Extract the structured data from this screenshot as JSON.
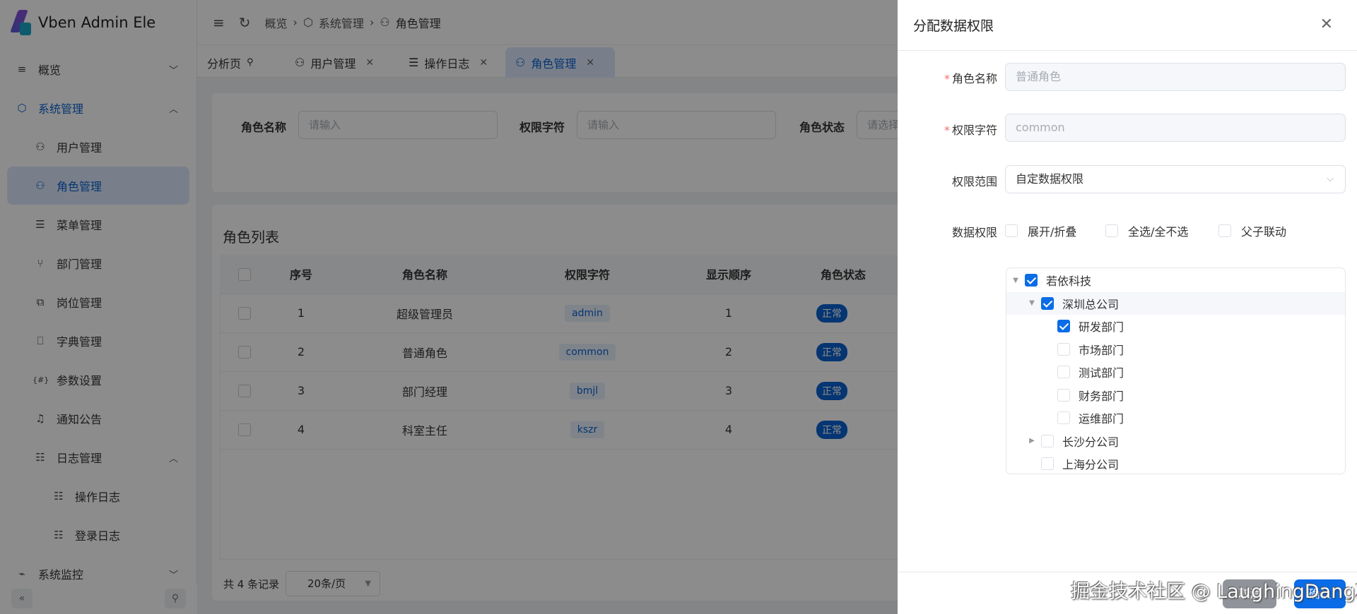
{
  "app": {
    "title": "Vben Admin Ele"
  },
  "colors": {
    "primary": "#0a6ce6",
    "required": "#f56c6c",
    "overlay": "rgba(0,0,0,0.45)"
  },
  "sidebar": {
    "items": [
      {
        "label": "概览",
        "icon": "dashboard-icon",
        "chevron": "down"
      },
      {
        "label": "系统管理",
        "icon": "system-icon",
        "chevron": "up",
        "open": true
      },
      {
        "label": "用户管理",
        "icon": "users-icon"
      },
      {
        "label": "角色管理",
        "icon": "user-role-icon",
        "active": true
      },
      {
        "label": "菜单管理",
        "icon": "menu-list-icon"
      },
      {
        "label": "部门管理",
        "icon": "org-tree-icon"
      },
      {
        "label": "岗位管理",
        "icon": "position-icon"
      },
      {
        "label": "字典管理",
        "icon": "bookmark-icon"
      },
      {
        "label": "参数设置",
        "icon": "params-icon"
      },
      {
        "label": "通知公告",
        "icon": "bell-icon"
      },
      {
        "label": "日志管理",
        "icon": "log-icon",
        "chevron": "up"
      },
      {
        "label": "操作日志",
        "icon": "oper-log-icon"
      },
      {
        "label": "登录日志",
        "icon": "login-log-icon"
      },
      {
        "label": "系统监控",
        "icon": "monitor-icon",
        "chevron": "down"
      }
    ]
  },
  "header": {
    "breadcrumb": [
      "概览",
      "系统管理",
      "角色管理"
    ]
  },
  "tabs": [
    {
      "label": "分析页",
      "closable": false
    },
    {
      "label": "用户管理",
      "closable": true
    },
    {
      "label": "操作日志",
      "closable": true
    },
    {
      "label": "角色管理",
      "closable": true,
      "active": true
    }
  ],
  "search": {
    "role_name_label": "角色名称",
    "role_name_placeholder": "请输入",
    "perm_label": "权限字符",
    "perm_placeholder": "请输入",
    "status_label": "角色状态",
    "status_placeholder": "请选择"
  },
  "table": {
    "title": "角色列表",
    "columns": [
      "序号",
      "角色名称",
      "权限字符",
      "显示顺序",
      "角色状态"
    ],
    "rows": [
      {
        "index": "1",
        "name": "超级管理员",
        "key": "admin",
        "order": "1",
        "status": "正常"
      },
      {
        "index": "2",
        "name": "普通角色",
        "key": "common",
        "order": "2",
        "status": "正常"
      },
      {
        "index": "3",
        "name": "部门经理",
        "key": "bmjl",
        "order": "3",
        "status": "正常"
      },
      {
        "index": "4",
        "name": "科室主任",
        "key": "kszr",
        "order": "4",
        "status": "正常"
      }
    ],
    "total": "共 4 条记录",
    "page_size": "20条/页"
  },
  "drawer": {
    "title": "分配数据权限",
    "role_name_label": "角色名称",
    "role_name_value": "普通角色",
    "perm_label": "权限字符",
    "perm_value": "common",
    "scope_label": "权限范围",
    "scope_value": "自定数据权限",
    "data_label": "数据权限",
    "options": [
      {
        "label": "展开/折叠",
        "checked": false
      },
      {
        "label": "全选/全不选",
        "checked": false
      },
      {
        "label": "父子联动",
        "checked": false
      }
    ],
    "tree": [
      {
        "label": "若依科技",
        "level": 0,
        "checked": true,
        "arrow": "down"
      },
      {
        "label": "深圳总公司",
        "level": 1,
        "checked": true,
        "arrow": "down",
        "highlight": true
      },
      {
        "label": "研发部门",
        "level": 2,
        "checked": true
      },
      {
        "label": "市场部门",
        "level": 2,
        "checked": false
      },
      {
        "label": "测试部门",
        "level": 2,
        "checked": false
      },
      {
        "label": "财务部门",
        "level": 2,
        "checked": false
      },
      {
        "label": "运维部门",
        "level": 2,
        "checked": false
      },
      {
        "label": "长沙分公司",
        "level": 1,
        "checked": false,
        "arrow": "right"
      },
      {
        "label": "上海分公司",
        "level": 1,
        "checked": false
      }
    ],
    "cancel": "取消",
    "confirm": "确认"
  },
  "watermark": "掘金技术社区 @ LaughingDangZi"
}
